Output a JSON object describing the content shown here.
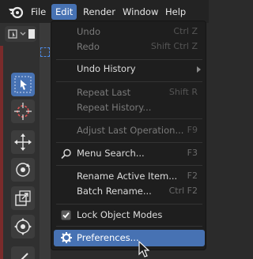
{
  "menubar": {
    "items": [
      {
        "label": "File"
      },
      {
        "label": "Edit"
      },
      {
        "label": "Render"
      },
      {
        "label": "Window"
      },
      {
        "label": "Help"
      }
    ]
  },
  "edit_menu": {
    "undo": {
      "label": "Undo",
      "shortcut": "Ctrl Z"
    },
    "redo": {
      "label": "Redo",
      "shortcut": "Shift Ctrl Z"
    },
    "undo_history": {
      "label": "Undo History"
    },
    "repeat_last": {
      "label": "Repeat Last",
      "shortcut": "Shift R"
    },
    "repeat_history": {
      "label": "Repeat History..."
    },
    "adjust_last": {
      "label": "Adjust Last Operation...",
      "shortcut": "F9"
    },
    "menu_search": {
      "label": "Menu Search...",
      "shortcut": "F3"
    },
    "rename_active": {
      "label": "Rename Active Item...",
      "shortcut": "F2"
    },
    "batch_rename": {
      "label": "Batch Rename...",
      "shortcut": "Ctrl F2"
    },
    "lock_object_modes": {
      "label": "Lock Object Modes",
      "checked": true
    },
    "preferences": {
      "label": "Preferences..."
    }
  },
  "colors": {
    "accent": "#4772b3",
    "menu_bg": "#1e1e1e",
    "menubar_bg": "#232323"
  }
}
